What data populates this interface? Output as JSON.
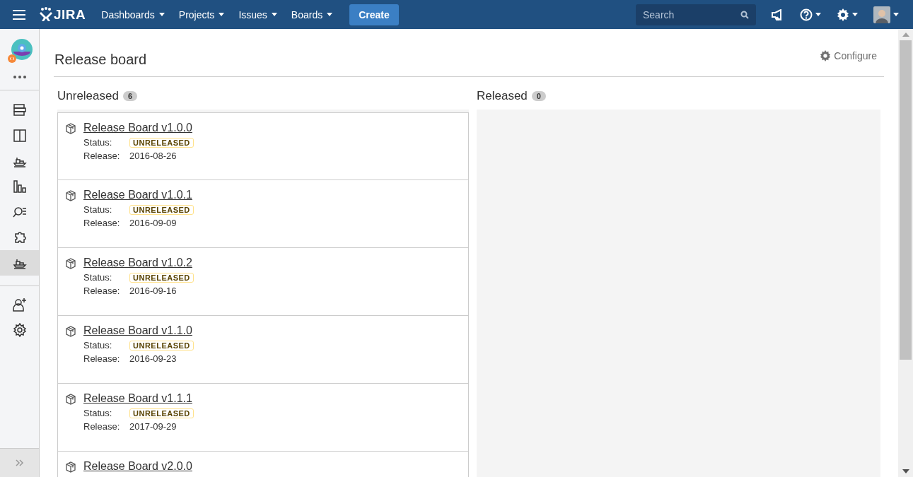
{
  "topbar": {
    "logo": "JIRA",
    "nav": [
      {
        "label": "Dashboards"
      },
      {
        "label": "Projects"
      },
      {
        "label": "Issues"
      },
      {
        "label": "Boards"
      }
    ],
    "create": "Create",
    "search": {
      "placeholder": "Search"
    }
  },
  "sidebar": {
    "items": [
      {
        "kind": "backlog",
        "selected": false
      },
      {
        "kind": "board",
        "selected": false
      },
      {
        "kind": "ship",
        "selected": false
      },
      {
        "kind": "reports",
        "selected": false
      },
      {
        "kind": "search",
        "selected": false
      },
      {
        "kind": "addon",
        "selected": false
      },
      {
        "kind": "ship",
        "selected": true
      }
    ],
    "admin": [
      {
        "kind": "invite",
        "selected": false
      },
      {
        "kind": "settings",
        "selected": false
      }
    ]
  },
  "page": {
    "title": "Release board",
    "configure": "Configure"
  },
  "columns": [
    {
      "title": "Unreleased",
      "count": "6",
      "versions": [
        {
          "name": "Release Board v1.0.0",
          "status_label": "Status:",
          "status": "UNRELEASED",
          "release_label": "Release:",
          "date": "2016-08-26"
        },
        {
          "name": "Release Board v1.0.1",
          "status_label": "Status:",
          "status": "UNRELEASED",
          "release_label": "Release:",
          "date": "2016-09-09"
        },
        {
          "name": "Release Board v1.0.2",
          "status_label": "Status:",
          "status": "UNRELEASED",
          "release_label": "Release:",
          "date": "2016-09-16"
        },
        {
          "name": "Release Board v1.1.0",
          "status_label": "Status:",
          "status": "UNRELEASED",
          "release_label": "Release:",
          "date": "2016-09-23"
        },
        {
          "name": "Release Board v1.1.1",
          "status_label": "Status:",
          "status": "UNRELEASED",
          "release_label": "Release:",
          "date": "2017-09-29"
        },
        {
          "name": "Release Board v2.0.0"
        }
      ]
    },
    {
      "title": "Released",
      "count": "0"
    }
  ]
}
